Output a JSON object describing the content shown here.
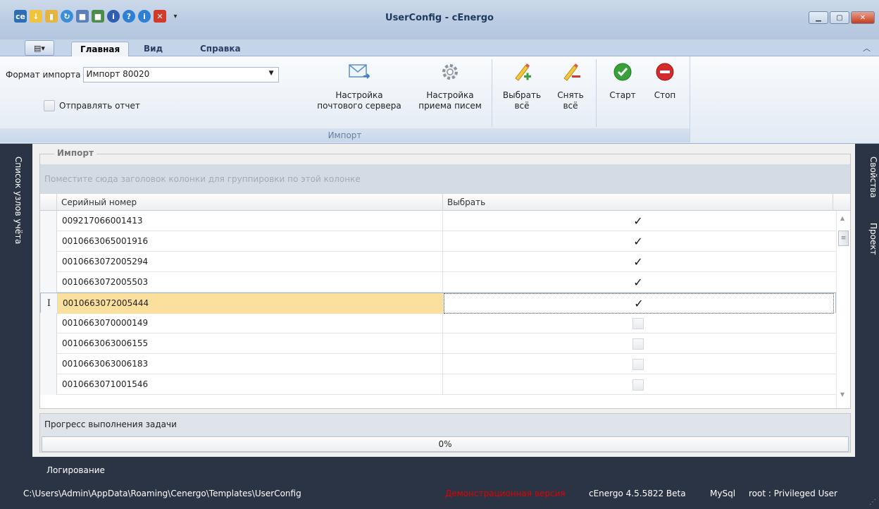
{
  "window": {
    "title": "UserConfig - cEnergo"
  },
  "qat": {
    "icons": [
      "app-logo-icon",
      "import-icon",
      "book-icon",
      "refresh-icon",
      "save-icon",
      "save-as-icon",
      "info-icon",
      "help-icon",
      "about-icon",
      "close-red-icon",
      "customize-icon"
    ]
  },
  "tabs": [
    {
      "label": "Главная"
    },
    {
      "label": "Вид"
    },
    {
      "label": "Справка"
    }
  ],
  "ribbon": {
    "format_label": "Формат импорта",
    "format_value": "Импорт 80020",
    "send_report_label": "Отправлять отчет",
    "send_report_checked": false,
    "group_label": "Импорт",
    "mail_server_label": [
      "Настройка",
      "почтового сервера"
    ],
    "receive_label": [
      "Настройка",
      "приема писем"
    ],
    "select_all_label": [
      "Выбрать",
      "всё"
    ],
    "deselect_all_label": [
      "Снять",
      "всё"
    ],
    "start_label": "Старт",
    "stop_label": "Стоп"
  },
  "left_panel": {
    "label": "Список узлов учёта"
  },
  "right_panel": {
    "tabs": [
      "Свойства",
      "Проект"
    ]
  },
  "import_box": {
    "title": "Импорт",
    "group_hint": "Поместите сюда заголовок колонки для группировки по этой колонке",
    "columns": [
      "Серийный номер",
      "Выбрать"
    ],
    "rows": [
      {
        "serial": "009217066001413",
        "checked": true,
        "selected": false
      },
      {
        "serial": "0010663065001916",
        "checked": true,
        "selected": false
      },
      {
        "serial": "0010663072005294",
        "checked": true,
        "selected": false
      },
      {
        "serial": "0010663072005503",
        "checked": true,
        "selected": false
      },
      {
        "serial": "0010663072005444",
        "checked": true,
        "selected": true
      },
      {
        "serial": "0010663070000149",
        "checked": false,
        "selected": false
      },
      {
        "serial": "0010663063006155",
        "checked": false,
        "selected": false
      },
      {
        "serial": "0010663063006183",
        "checked": false,
        "selected": false
      },
      {
        "serial": "0010663071001546",
        "checked": false,
        "selected": false
      }
    ]
  },
  "progress": {
    "label": "Прогресс выполнения задачи",
    "value": "0%"
  },
  "status": {
    "log_label": "Логирование",
    "path": "C:\\Users\\Admin\\AppData\\Roaming\\Cenergo\\Templates\\UserConfig",
    "demo": "Демонстрационная версия",
    "version": "cEnergo 4.5.5822 Beta",
    "db": "MySql",
    "user": "root : Privileged User"
  },
  "colors": {
    "accent": "#2b3445",
    "selection": "#fbdf9d",
    "demo": "#e00000"
  }
}
